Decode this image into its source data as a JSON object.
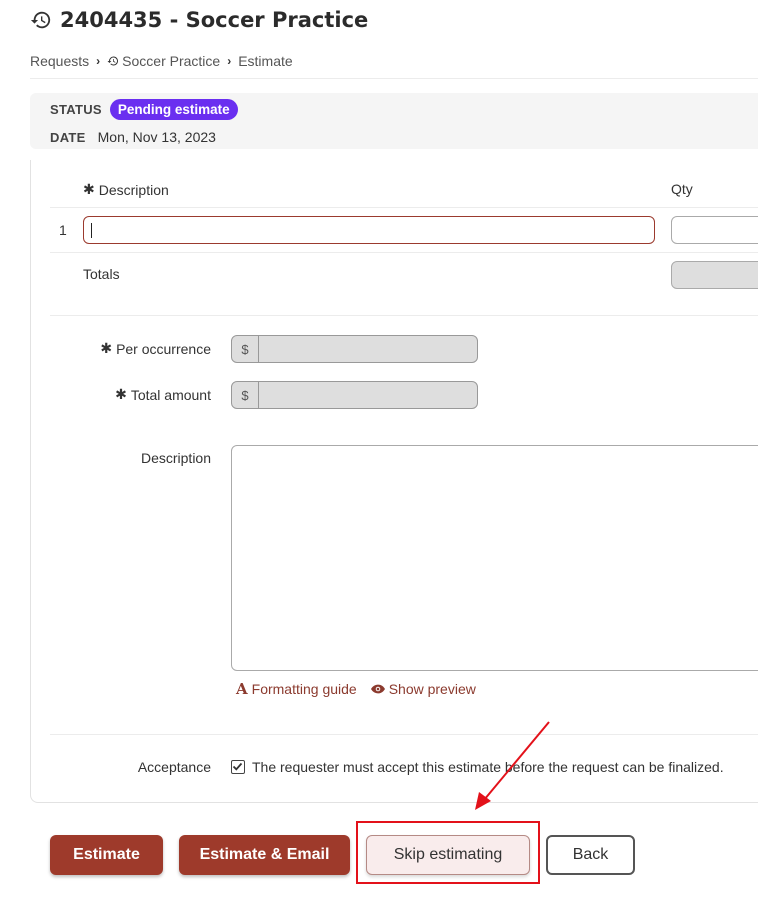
{
  "header": {
    "title": "2404435 - Soccer Practice",
    "icon": "history-icon"
  },
  "breadcrumb": {
    "items": [
      "Requests",
      "Soccer Practice",
      "Estimate"
    ]
  },
  "status": {
    "label": "STATUS",
    "value": "Pending estimate",
    "badge_color": "#6a2ff0",
    "date_label": "DATE",
    "date_value": "Mon, Nov 13, 2023"
  },
  "items_table": {
    "col_description": "Description",
    "col_qty": "Qty",
    "row_number": "1",
    "description_value": "",
    "qty_value": "",
    "totals_label": "Totals"
  },
  "form": {
    "per_occurrence_label": "Per occurrence",
    "total_amount_label": "Total amount",
    "currency_symbol": "$",
    "description_label": "Description",
    "formatting_guide": "Formatting guide",
    "show_preview": "Show preview",
    "acceptance_label": "Acceptance",
    "acceptance_text": "The requester must accept this estimate before the request can be finalized.",
    "acceptance_checked": true
  },
  "actions": {
    "estimate": "Estimate",
    "estimate_email": "Estimate & Email",
    "skip": "Skip estimating",
    "back": "Back"
  },
  "colors": {
    "primary": "#9e3a2b",
    "highlight": "#e3111a"
  }
}
